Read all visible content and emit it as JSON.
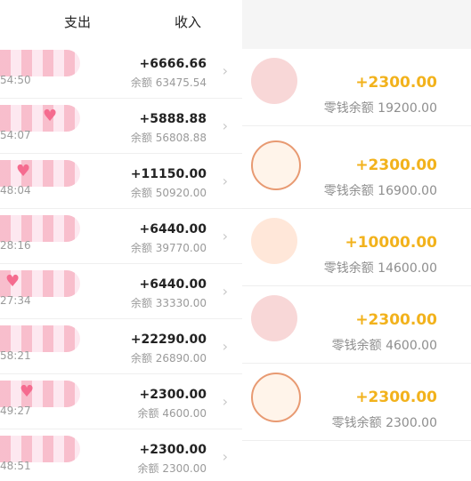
{
  "left": {
    "tabs": {
      "expense": "支出",
      "income": "收入"
    },
    "rows": [
      {
        "time": "54:50",
        "amount": "+6666.66",
        "balance": "余额 63475.54"
      },
      {
        "time": "54:07",
        "amount": "+5888.88",
        "balance": "余额 56808.88"
      },
      {
        "time": "48:04",
        "amount": "+11150.00",
        "balance": "余额 50920.00"
      },
      {
        "time": "28:16",
        "amount": "+6440.00",
        "balance": "余额 39770.00"
      },
      {
        "time": "27:34",
        "amount": "+6440.00",
        "balance": "余额 33330.00"
      },
      {
        "time": "58:21",
        "amount": "+22290.00",
        "balance": "余额 26890.00"
      },
      {
        "time": "49:27",
        "amount": "+2300.00",
        "balance": "余额 4600.00"
      },
      {
        "time": "48:51",
        "amount": "+2300.00",
        "balance": "余额 2300.00"
      }
    ]
  },
  "right": {
    "rows": [
      {
        "amount": "+2300.00",
        "balance": "零钱余额 19200.00"
      },
      {
        "amount": "+2300.00",
        "balance": "零钱余额 16900.00"
      },
      {
        "amount": "+10000.00",
        "balance": "零钱余额 14600.00"
      },
      {
        "amount": "+2300.00",
        "balance": "零钱余额 4600.00"
      },
      {
        "amount": "+2300.00",
        "balance": "零钱余额 2300.00"
      }
    ]
  },
  "colors": {
    "income_amount": "#f2b21c",
    "left_amount": "#222222",
    "secondary_text": "#9a9a9a"
  },
  "icons": [
    "chevron-right-icon",
    "heart-sticker-icon",
    "cartoon-avatar-icon"
  ]
}
